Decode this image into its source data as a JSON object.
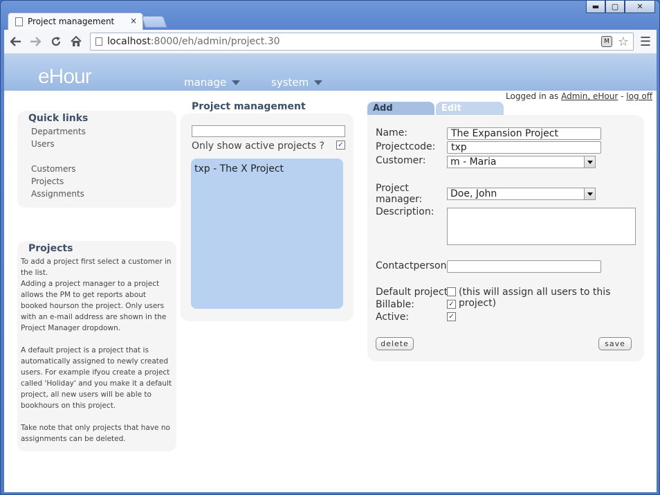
{
  "browser": {
    "tab_title": "Project management",
    "tab_close": "×",
    "url_host": "localhost",
    "url_path": ":8000/eh/admin/project.30",
    "win_minimize": "▬",
    "win_maximize": "▢",
    "win_close": "✕",
    "icons": [
      "back-icon",
      "forward-icon",
      "reload-icon",
      "home-icon",
      "page-icon",
      "extension-icon",
      "bookmark-star-icon",
      "menu-icon"
    ]
  },
  "header": {
    "logo": "eHour",
    "nav": [
      {
        "label": "manage"
      },
      {
        "label": "system"
      }
    ],
    "logged_prefix": "Logged in as",
    "user_link": "Admin, eHour",
    "separator": "-",
    "logoff": "log off"
  },
  "quicklinks": {
    "title": "Quick links",
    "items": [
      "Departments",
      "Users",
      "Customers",
      "Projects",
      "Assignments"
    ]
  },
  "help": {
    "title": "Projects",
    "p1": "To add a project first select a customer in the list.",
    "p2": "Adding a project manager to a project allows the PM to get reports about booked hourson the project. Only users with an e-mail address are shown in the Project Manager dropdown.",
    "p3": "A default project is a project that is automatically assigned to newly created users. For example ifyou create a project called 'Holiday' and you make it a default project, all new users will be able to bookhours on this project.",
    "p4": "Take note that only projects that have no assignments can be deleted."
  },
  "projects_panel": {
    "title": "Project management",
    "filter_value": "",
    "active_only_label": "Only show active projects ?",
    "active_only_checked": true,
    "list": [
      "txp - The X Project"
    ]
  },
  "form": {
    "tabs": [
      "Add project",
      "Edit project"
    ],
    "name_label": "Name:",
    "name_value": "The Expansion Project",
    "code_label": "Projectcode:",
    "code_value": "txp",
    "customer_label": "Customer:",
    "customer_value": "m - Maria",
    "pm_label_1": "Project",
    "pm_label_2": "manager:",
    "pm_value": "Doe, John",
    "description_label": "Description:",
    "description_value": "",
    "contact_label": "Contactperson:",
    "contact_value": "",
    "default_label": "Default project:",
    "default_checked": false,
    "default_note": "(this will assign all users to this project)",
    "billable_label": "Billable:",
    "billable_checked": true,
    "active_label": "Active:",
    "active_checked": true,
    "delete_label": "delete",
    "save_label": "save",
    "check_mark": "✓"
  }
}
